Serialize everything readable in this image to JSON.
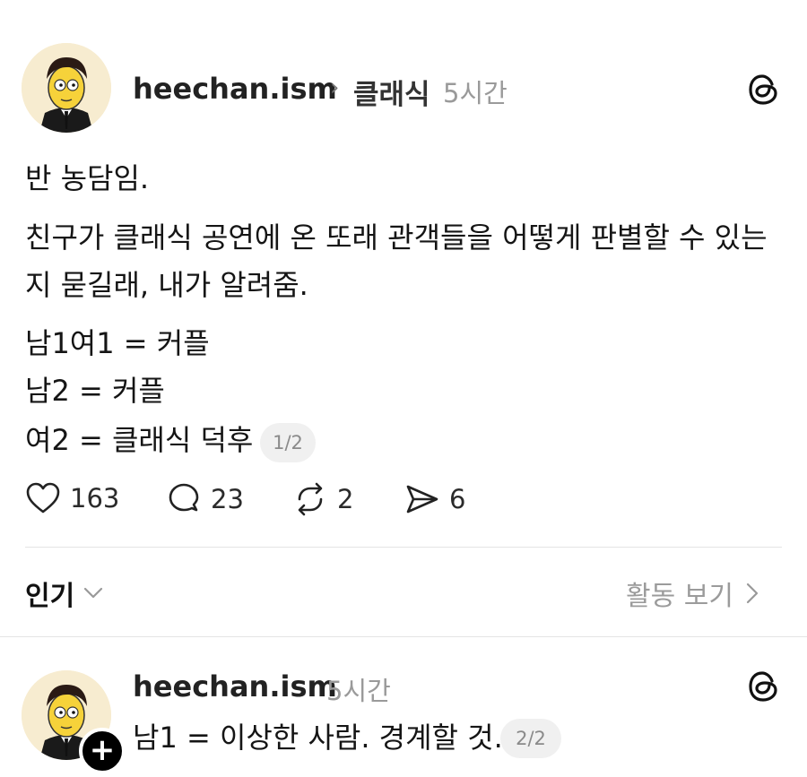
{
  "post": {
    "username": "heechan.ism",
    "topic": "클래식",
    "time": "5시간",
    "lines": [
      "반 농담임.",
      "친구가 클래식 공연에 온 또래 관객들을 어떻게 판별할 수 있는",
      "지 묻길래, 내가 알려줌.",
      "남1여1 = 커플",
      "남2 = 커플",
      "여2 = 클래식 덕후"
    ],
    "page_indicator": "1/2",
    "actions": {
      "likes": "163",
      "comments": "23",
      "reposts": "2",
      "shares": "6"
    }
  },
  "sort": {
    "label": "인기",
    "activity_link": "활동 보기"
  },
  "reply": {
    "username": "heechan.ism",
    "time": "5시간",
    "text": "남1 = 이상한 사람. 경계할 것.",
    "page_indicator": "2/2"
  },
  "icons": {
    "threads": "threads-logo-icon",
    "like": "heart-icon",
    "comment": "comment-bubble-icon",
    "repost": "repost-icon",
    "share": "send-icon",
    "chevron": "chevron-right-icon",
    "dropdown": "chevron-down-icon",
    "plus": "plus-icon"
  }
}
